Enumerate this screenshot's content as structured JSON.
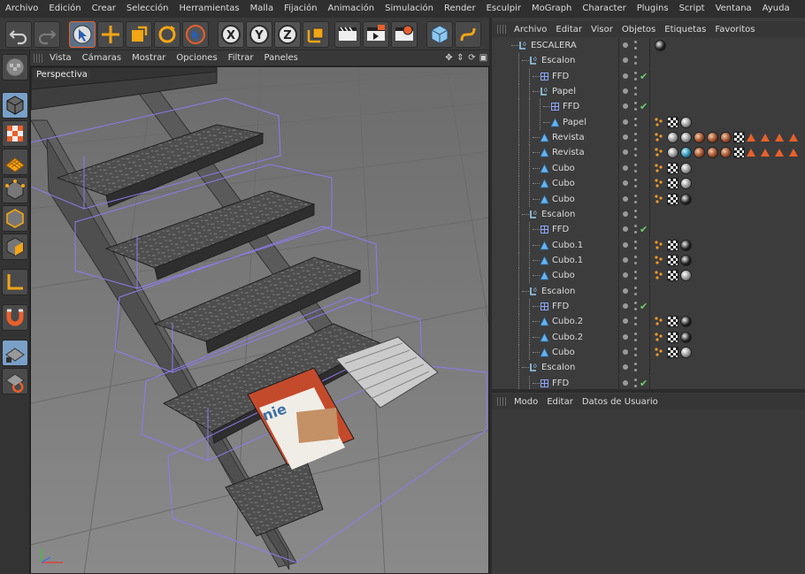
{
  "menu": [
    "Archivo",
    "Edición",
    "Crear",
    "Selección",
    "Herramientas",
    "Malla",
    "Fijación",
    "Animación",
    "Simulación",
    "Render",
    "Esculpir",
    "MoGraph",
    "Character",
    "Plugins",
    "Script",
    "Ventana",
    "Ayuda"
  ],
  "toolbar": {
    "undo": "undo-icon",
    "redo": "redo-icon",
    "live_select": "cursor-icon",
    "move": "move-icon",
    "scale": "scale-icon",
    "rotate": "rotate-icon",
    "last_tool": "cursor-icon",
    "axis_x": "X",
    "axis_y": "Y",
    "axis_z": "Z",
    "coord": "coordinate-system-icon",
    "render_view": "render-view-icon",
    "render_picture": "render-picture-icon",
    "render_settings": "render-settings-icon",
    "cube": "cube-icon",
    "spline": "spline-icon"
  },
  "viewport": {
    "menu": [
      "Vista",
      "Cámaras",
      "Mostrar",
      "Opciones",
      "Filtrar",
      "Paneles"
    ],
    "label": "Perspectiva"
  },
  "object_manager": {
    "menu": [
      "Archivo",
      "Editar",
      "Visor",
      "Objetos",
      "Etiquetas",
      "Favoritos"
    ],
    "rows": [
      {
        "name": "ESCALERA",
        "type": "null",
        "level": 0
      },
      {
        "name": "Escalon",
        "type": "null",
        "level": 1
      },
      {
        "name": "FFD",
        "type": "ffd",
        "level": 2,
        "check": true
      },
      {
        "name": "Papel",
        "type": "null",
        "level": 2
      },
      {
        "name": "FFD",
        "type": "ffd",
        "level": 3,
        "check": true
      },
      {
        "name": "Papel",
        "type": "poly",
        "level": 3
      },
      {
        "name": "Revista",
        "type": "poly",
        "level": 2
      },
      {
        "name": "Revista",
        "type": "poly",
        "level": 2
      },
      {
        "name": "Cubo",
        "type": "poly",
        "level": 2
      },
      {
        "name": "Cubo",
        "type": "poly",
        "level": 2
      },
      {
        "name": "Cubo",
        "type": "poly",
        "level": 2
      },
      {
        "name": "Escalon",
        "type": "null",
        "level": 1
      },
      {
        "name": "FFD",
        "type": "ffd",
        "level": 2,
        "check": true
      },
      {
        "name": "Cubo.1",
        "type": "poly",
        "level": 2
      },
      {
        "name": "Cubo.1",
        "type": "poly",
        "level": 2
      },
      {
        "name": "Cubo",
        "type": "poly",
        "level": 2
      },
      {
        "name": "Escalon",
        "type": "null",
        "level": 1
      },
      {
        "name": "FFD",
        "type": "ffd",
        "level": 2,
        "check": true
      },
      {
        "name": "Cubo.2",
        "type": "poly",
        "level": 2
      },
      {
        "name": "Cubo.2",
        "type": "poly",
        "level": 2
      },
      {
        "name": "Cubo",
        "type": "poly",
        "level": 2
      },
      {
        "name": "Escalon",
        "type": "null",
        "level": 1
      },
      {
        "name": "FFD",
        "type": "ffd",
        "level": 2,
        "check": true
      }
    ]
  },
  "attribute_manager": {
    "menu": [
      "Modo",
      "Editar",
      "Datos de Usuario"
    ]
  },
  "colors": {
    "accent": "#7aa0c8",
    "active_tool": "#e8602c",
    "check": "#6ad36a"
  }
}
